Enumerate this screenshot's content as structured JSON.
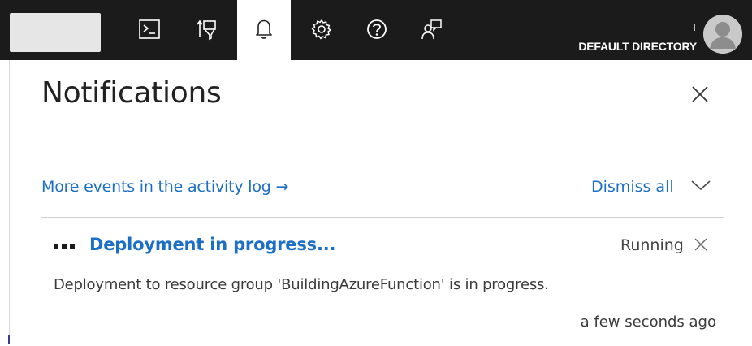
{
  "topbar": {
    "directory_label": "DEFAULT DIRECTORY",
    "icons": [
      "cloud-shell-icon",
      "directory-filter-icon",
      "notifications-icon",
      "settings-icon",
      "help-icon",
      "feedback-icon"
    ]
  },
  "panel": {
    "title": "Notifications",
    "activity_link": "More events in the activity log →",
    "dismiss_all": "Dismiss all"
  },
  "notification": {
    "title": "Deployment in progress...",
    "status": "Running",
    "description": "Deployment to resource group 'BuildingAzureFunction' is in progress.",
    "time": "a few seconds ago"
  },
  "colors": {
    "topbar_bg": "#1b1b1b",
    "link": "#1c6fc7",
    "text": "#222222"
  }
}
